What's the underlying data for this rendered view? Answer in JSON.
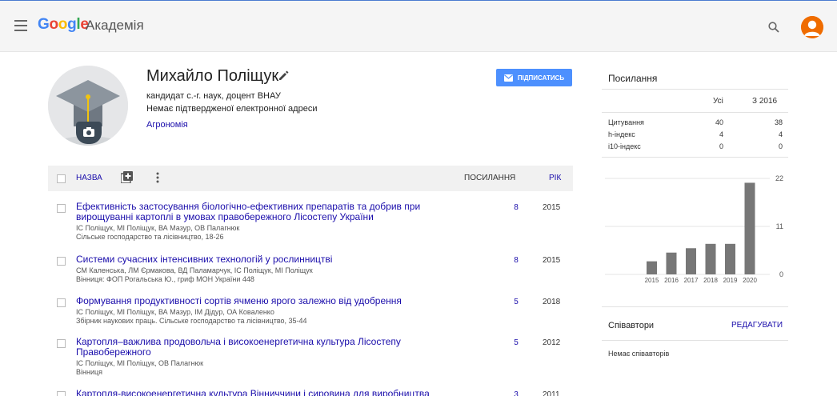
{
  "header": {
    "logo": "Google",
    "section": "Академія"
  },
  "profile": {
    "name": "Михайло Поліщук",
    "affiliation": "кандидат с.-г. наук, доцент ВНАУ",
    "email": "Немає підтвердженої електронної адреси",
    "interest": "Агрономія",
    "follow_label": "ПІДПИСАТИСЬ"
  },
  "table": {
    "title_label": "НАЗВА",
    "cites_label": "ПОСИЛАННЯ",
    "year_label": "РІК"
  },
  "publications": [
    {
      "title": "Ефективність застосування біологічно-ефективних препаратів та добрив при вирощуванні картоплі в умовах правобережного Лісостепу України",
      "authors": "ІС Поліщук, МІ Поліщук, ВА Мазур, ОВ Палагнюк",
      "venue": "Сільське господарство та лісівництво, 18-26",
      "cites": "8",
      "year": "2015"
    },
    {
      "title": "Системи сучасних інтенсивних технологій у рослинництві",
      "authors": "СМ Каленська, ЛМ Єрмакова, ВД Паламарчук, ІС Поліщук, МІ Поліщук",
      "venue": "Вінниця: ФОП Рогальська Ю., гриф МОН України 448",
      "cites": "8",
      "year": "2015"
    },
    {
      "title": "Формування продуктивності сортів ячменю ярого залежно від удобрення",
      "authors": "ІС Поліщук, МІ Поліщук, ВА Мазур, ІМ Дідур, ОА Коваленко",
      "venue": "Збірник наукових праць. Сільське господарство та лісівництво, 35-44",
      "cites": "5",
      "year": "2018"
    },
    {
      "title": "Картопля–важлива продовольча і високоенергетична культура Лісостепу Правобережного",
      "authors": "ІС Поліщук, МІ Поліщук, ОВ Палагнюк",
      "venue": "Вінниця",
      "cites": "5",
      "year": "2012"
    },
    {
      "title": "Картопля-високоенергетична культура Вінниччини і сировина для виробництва",
      "authors": "",
      "venue": "",
      "cites": "3",
      "year": "2011"
    }
  ],
  "citations": {
    "title": "Посилання",
    "col_all": "Усі",
    "col_since": "З 2016",
    "rows": [
      {
        "label": "Цитування",
        "all": "40",
        "since": "38"
      },
      {
        "label": "h-індекс",
        "all": "4",
        "since": "4"
      },
      {
        "label": "i10-індекс",
        "all": "0",
        "since": "0"
      }
    ]
  },
  "chart_data": {
    "type": "bar",
    "categories": [
      "2015",
      "2016",
      "2017",
      "2018",
      "2019",
      "2020"
    ],
    "values": [
      3,
      5,
      6,
      7,
      7,
      21
    ],
    "ylim": [
      0,
      22
    ],
    "yticks": [
      "0",
      "11",
      "22"
    ],
    "grid": true
  },
  "coauthors": {
    "title": "Співавтори",
    "edit_label": "РЕДАГУВАТИ",
    "empty_text": "Немає співавторів"
  },
  "colors": {
    "link": "#1a0dab",
    "button": "#4d90fe",
    "bar": "#777777",
    "avatar": "#ef6c00"
  }
}
